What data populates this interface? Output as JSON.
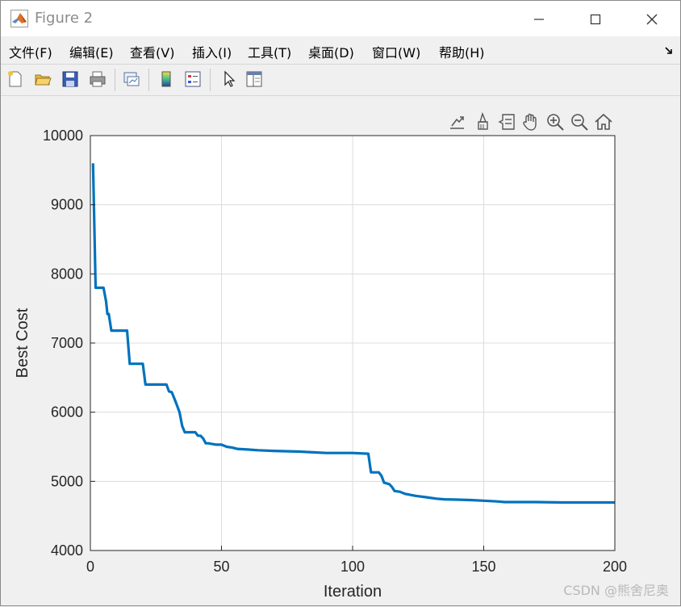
{
  "window": {
    "title": "Figure 2"
  },
  "menu": [
    "文件(F)",
    "编辑(E)",
    "查看(V)",
    "插入(I)",
    "工具(T)",
    "桌面(D)",
    "窗口(W)",
    "帮助(H)"
  ],
  "toolbar_icons": [
    "new-figure-icon",
    "open-file-icon",
    "save-icon",
    "print-icon",
    "link-plot-icon",
    "colorbar-icon",
    "legend-icon",
    "edit-plot-icon",
    "property-inspector-icon"
  ],
  "axes_toolbar_icons": [
    "export-icon",
    "brush-icon",
    "data-tips-icon",
    "pan-icon",
    "zoom-in-icon",
    "zoom-out-icon",
    "home-icon"
  ],
  "watermark": "CSDN @熊舍尼奥",
  "chart_data": {
    "type": "line",
    "title": "",
    "xlabel": "Iteration",
    "ylabel": "Best Cost",
    "xlim": [
      0,
      200
    ],
    "ylim": [
      4000,
      10000
    ],
    "xticks": [
      0,
      50,
      100,
      150,
      200
    ],
    "yticks": [
      4000,
      5000,
      6000,
      7000,
      8000,
      9000,
      10000
    ],
    "grid": true,
    "color": "#0072bd",
    "series": [
      {
        "x": [
          1,
          2,
          5,
          6,
          6.5,
          7,
          8,
          14,
          15,
          20,
          21,
          29,
          30,
          31,
          32,
          33,
          34,
          35,
          36,
          40,
          41,
          42,
          43,
          44,
          45,
          48,
          50,
          52,
          54,
          56,
          60,
          64,
          70,
          80,
          85,
          90,
          100,
          106,
          107,
          110,
          111,
          112,
          114,
          115,
          116,
          118,
          120,
          124,
          128,
          132,
          135,
          140,
          145,
          150,
          155,
          158,
          160,
          170,
          180,
          190,
          200
        ],
        "y": [
          9600,
          7800,
          7800,
          7600,
          7420,
          7420,
          7180,
          7180,
          6700,
          6700,
          6400,
          6400,
          6300,
          6290,
          6200,
          6100,
          6000,
          5800,
          5710,
          5710,
          5660,
          5660,
          5620,
          5550,
          5550,
          5530,
          5530,
          5500,
          5490,
          5470,
          5460,
          5450,
          5440,
          5430,
          5420,
          5410,
          5410,
          5400,
          5130,
          5130,
          5080,
          4980,
          4960,
          4920,
          4860,
          4850,
          4820,
          4790,
          4770,
          4750,
          4740,
          4735,
          4730,
          4720,
          4710,
          4700,
          4700,
          4700,
          4695,
          4695,
          4695
        ]
      }
    ]
  }
}
